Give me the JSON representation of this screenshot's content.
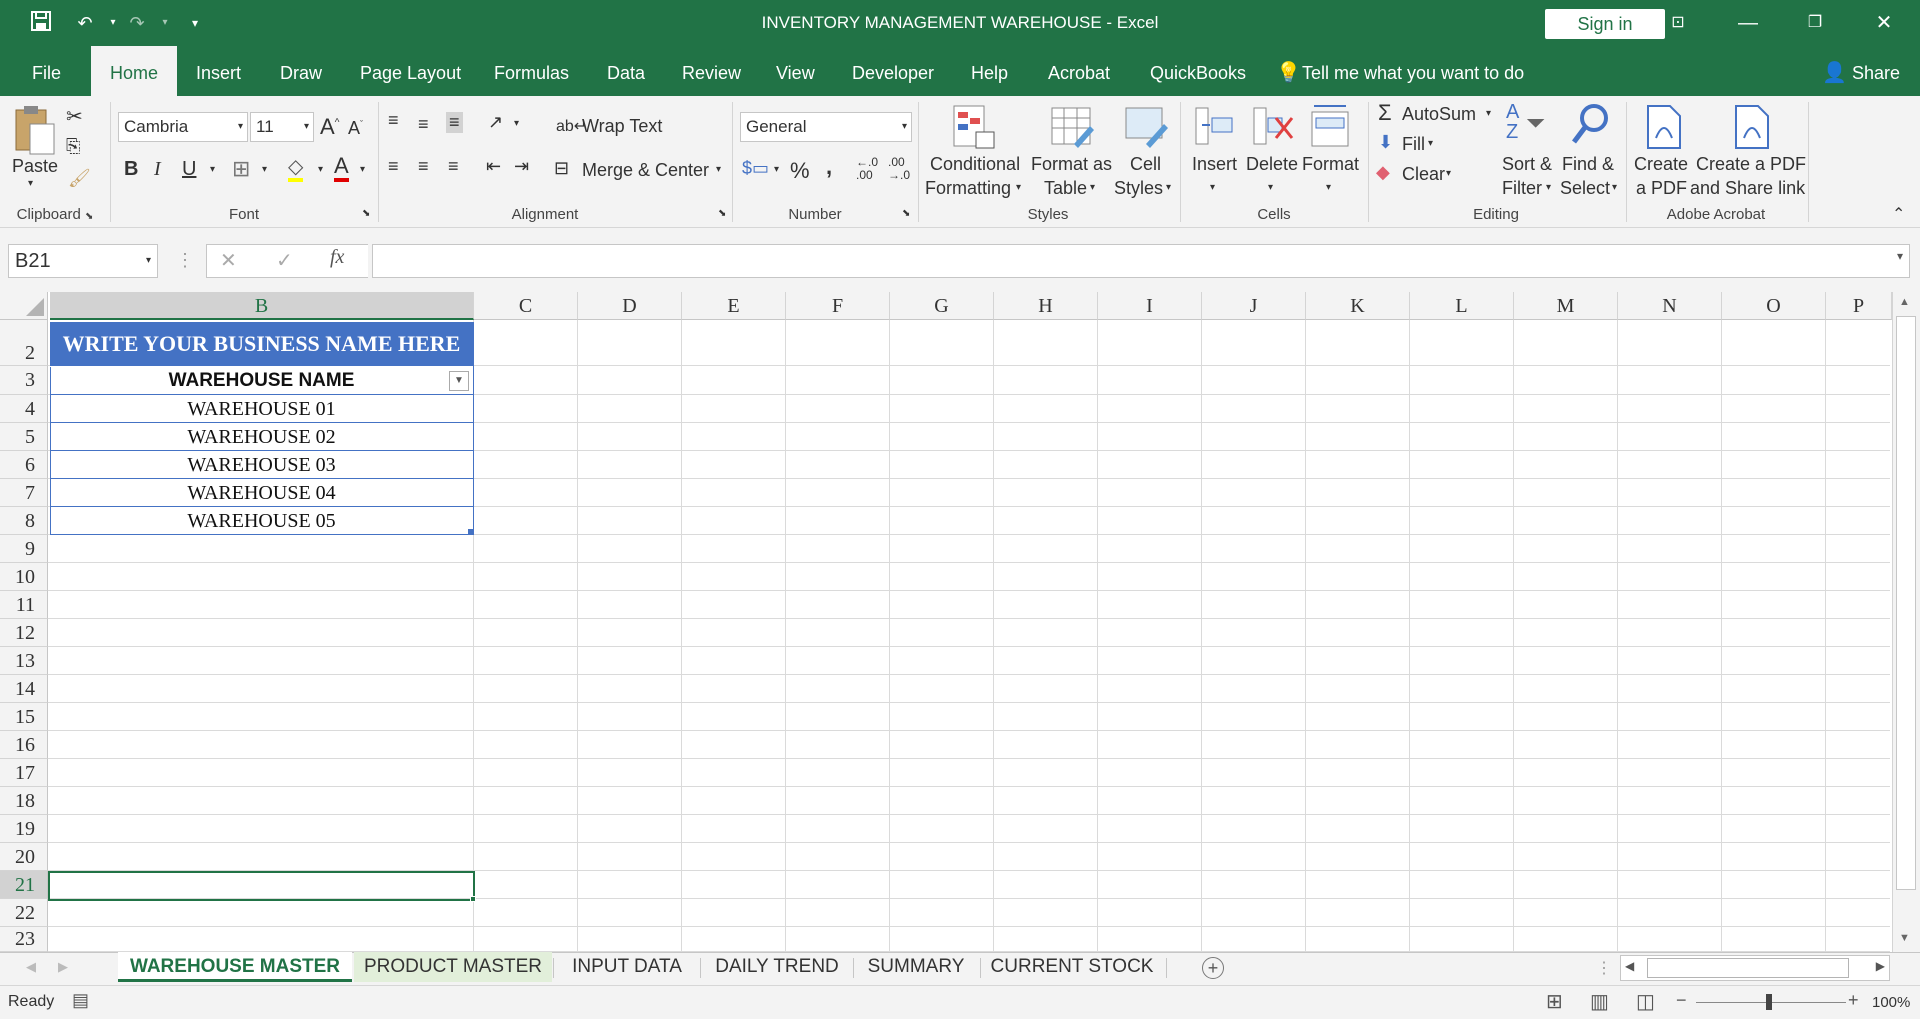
{
  "window": {
    "title": "INVENTORY MANAGEMENT WAREHOUSE  -  Excel",
    "sign_in": "Sign in"
  },
  "menu": {
    "tabs": [
      "File",
      "Home",
      "Insert",
      "Draw",
      "Page Layout",
      "Formulas",
      "Data",
      "Review",
      "View",
      "Developer",
      "Help",
      "Acrobat",
      "QuickBooks"
    ],
    "tell_me": "Tell me what you want to do",
    "share": "Share"
  },
  "ribbon": {
    "clipboard": {
      "paste": "Paste",
      "label": "Clipboard"
    },
    "font": {
      "name": "Cambria",
      "size": "11",
      "label": "Font",
      "bold": "B",
      "italic": "I",
      "underline": "U"
    },
    "alignment": {
      "wrap": "Wrap Text",
      "merge": "Merge & Center",
      "label": "Alignment"
    },
    "number": {
      "format": "General",
      "percent": "%",
      "comma": ",",
      "label": "Number"
    },
    "styles": {
      "conditional_1": "Conditional",
      "conditional_2": "Formatting",
      "format_table_1": "Format as",
      "format_table_2": "Table",
      "cell_styles_1": "Cell",
      "cell_styles_2": "Styles",
      "label": "Styles"
    },
    "cells": {
      "insert": "Insert",
      "delete": "Delete",
      "format": "Format",
      "label": "Cells"
    },
    "editing": {
      "autosum": "AutoSum",
      "fill": "Fill",
      "clear": "Clear",
      "sort_1": "Sort &",
      "sort_2": "Filter",
      "find_1": "Find &",
      "find_2": "Select",
      "label": "Editing"
    },
    "acrobat": {
      "create_1": "Create",
      "create_2": "a PDF",
      "share_1": "Create a PDF",
      "share_2": "and Share link",
      "label": "Adobe Acrobat"
    }
  },
  "formula_bar": {
    "name_box": "B21",
    "fx": "fx",
    "value": ""
  },
  "columns": [
    "B",
    "C",
    "D",
    "E",
    "F",
    "G",
    "H",
    "I",
    "J",
    "K",
    "L",
    "M",
    "N",
    "O",
    "P"
  ],
  "rows": [
    "2",
    "3",
    "4",
    "5",
    "6",
    "7",
    "8",
    "9",
    "10",
    "11",
    "12",
    "13",
    "14",
    "15",
    "16",
    "17",
    "18",
    "19",
    "20",
    "21",
    "22",
    "23"
  ],
  "sheet": {
    "banner": "WRITE YOUR BUSINESS NAME HERE",
    "table_header": "WAREHOUSE NAME",
    "warehouses": [
      "WAREHOUSE 01",
      "WAREHOUSE 02",
      "WAREHOUSE 03",
      "WAREHOUSE 04",
      "WAREHOUSE 05"
    ]
  },
  "sheet_tabs": [
    "WAREHOUSE MASTER",
    "PRODUCT MASTER",
    "INPUT DATA",
    "DAILY TREND",
    "SUMMARY",
    "CURRENT STOCK"
  ],
  "status": {
    "ready": "Ready",
    "zoom": "100%"
  },
  "colors": {
    "excel_green": "#217346",
    "banner_blue": "#4472c4"
  }
}
